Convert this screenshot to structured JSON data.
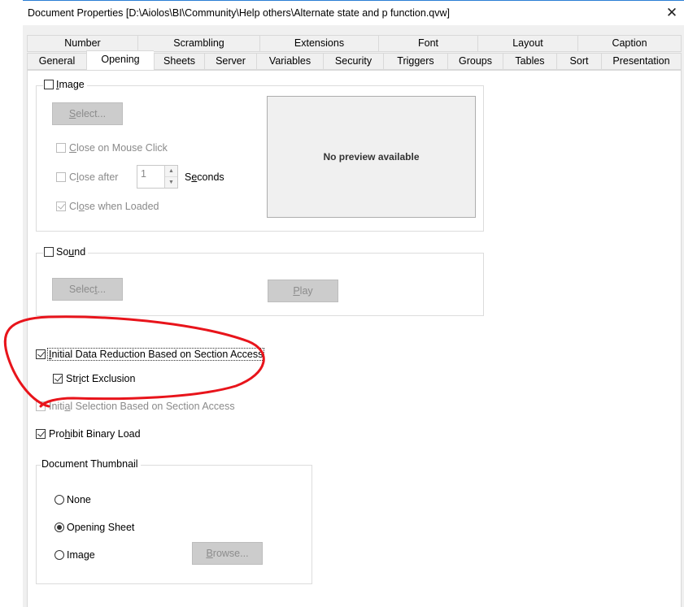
{
  "window": {
    "title": "Document Properties [D:\\Aiolos\\BI\\Community\\Help others\\Alternate state and p function.qvw]",
    "close_glyph": "✕"
  },
  "tabs": {
    "top_row": [
      "Number",
      "Scrambling",
      "Extensions",
      "Font",
      "Layout",
      "Caption"
    ],
    "bottom_row": [
      "General",
      "Opening",
      "Sheets",
      "Server",
      "Variables",
      "Security",
      "Triggers",
      "Groups",
      "Tables",
      "Sort",
      "Presentation"
    ],
    "selected": "Opening"
  },
  "image_group": {
    "label_pre": "",
    "label_ul": "I",
    "label_post": "mage",
    "checked": false,
    "select_button": {
      "pre": "",
      "ul": "S",
      "post": "elect..."
    },
    "close_on_click": {
      "pre": "",
      "ul": "C",
      "post": "lose on Mouse Click",
      "checked": false,
      "enabled": false
    },
    "close_after": {
      "pre": "C",
      "ul": "l",
      "post": "ose after",
      "checked": false,
      "enabled": false
    },
    "seconds_value": "1",
    "seconds_label": {
      "pre": "S",
      "ul": "e",
      "post": "conds"
    },
    "close_when_loaded": {
      "pre": "Cl",
      "ul": "o",
      "post": "se when Loaded",
      "checked": true,
      "enabled": false
    },
    "preview_text": "No preview available"
  },
  "sound_group": {
    "label": {
      "pre": "So",
      "ul": "u",
      "post": "nd"
    },
    "checked": false,
    "select_button": {
      "pre": "Selec",
      "ul": "t",
      "post": "..."
    },
    "play_button": {
      "pre": "",
      "ul": "P",
      "post": "lay"
    }
  },
  "options": {
    "initial_data_reduction": {
      "pre": "",
      "ul": "I",
      "post": "nitial Data Reduction Based on Section Access",
      "checked": true
    },
    "strict_exclusion": {
      "pre": "Str",
      "ul": "i",
      "post": "ct Exclusion",
      "checked": true
    },
    "initial_selection": {
      "pre": "Initi",
      "ul": "a",
      "post": "l Selection Based on Section Access",
      "checked": false,
      "enabled": false
    },
    "prohibit_binary_load": {
      "pre": "Pro",
      "ul": "h",
      "post": "ibit Binary Load",
      "checked": true
    }
  },
  "thumbnail_group": {
    "label": "Document Thumbnail",
    "options": [
      "None",
      "Opening Sheet",
      "Image"
    ],
    "selected": "Opening Sheet",
    "browse_button": {
      "pre": "",
      "ul": "B",
      "post": "rowse..."
    }
  },
  "annotation": {
    "color": "#e8141b"
  }
}
